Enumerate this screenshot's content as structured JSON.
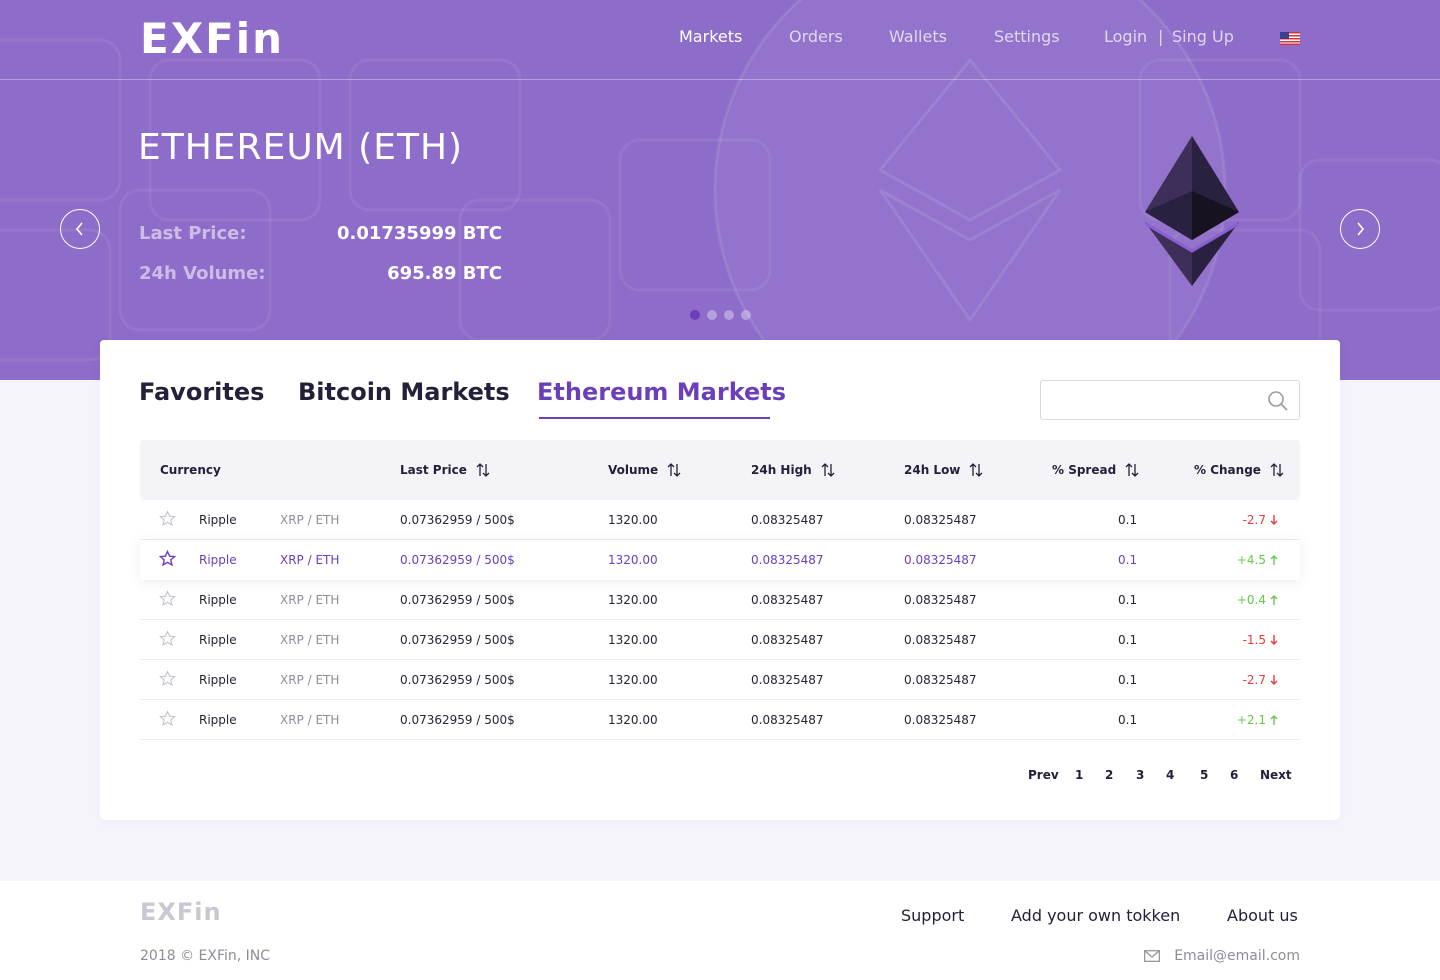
{
  "header": {
    "logo": "EXFin",
    "nav": [
      {
        "label": "Markets"
      },
      {
        "label": "Orders"
      },
      {
        "label": "Wallets"
      },
      {
        "label": "Settings"
      },
      {
        "label": "Login"
      },
      {
        "label": "Sing Up"
      }
    ],
    "nav_separator": "|",
    "language_flag_icon": "us-flag-icon"
  },
  "hero": {
    "title": "ETHEREUM (ETH)",
    "last_price_label": "Last Price:",
    "last_price_value": "0.01735999 BTC",
    "volume_label": "24h Volume:",
    "volume_value": "695.89 BTC",
    "prev_icon": "chevron-left-icon",
    "next_icon": "chevron-right-icon",
    "slide_count": 4,
    "active_slide": 1,
    "coin_icon": "ethereum-icon"
  },
  "markets": {
    "tabs": [
      {
        "label": "Favorites"
      },
      {
        "label": "Bitcoin Markets"
      },
      {
        "label": "Ethereum Markets"
      }
    ],
    "active_tab": 2,
    "search": {
      "value": "",
      "placeholder": "",
      "icon": "search-icon"
    },
    "columns": [
      {
        "label": "Currency",
        "sortable": false
      },
      {
        "label": "Last Price",
        "sortable": true
      },
      {
        "label": "Volume",
        "sortable": true
      },
      {
        "label": "24h High",
        "sortable": true
      },
      {
        "label": "24h Low",
        "sortable": true
      },
      {
        "label": "% Spread",
        "sortable": true
      },
      {
        "label": "% Change",
        "sortable": true
      }
    ],
    "rows": [
      {
        "name": "Ripple",
        "pair": "XRP / ETH",
        "last_price": "0.07362959 / 500$",
        "volume": "1320.00",
        "high": "0.08325487",
        "low": "0.08325487",
        "spread": "0.1",
        "change": "-2.7",
        "dir": "down",
        "favorite": false,
        "highlighted": false
      },
      {
        "name": "Ripple",
        "pair": "XRP / ETH",
        "last_price": "0.07362959 / 500$",
        "volume": "1320.00",
        "high": "0.08325487",
        "low": "0.08325487",
        "spread": "0.1",
        "change": "+4.5",
        "dir": "up",
        "favorite": true,
        "highlighted": true
      },
      {
        "name": "Ripple",
        "pair": "XRP / ETH",
        "last_price": "0.07362959 / 500$",
        "volume": "1320.00",
        "high": "0.08325487",
        "low": "0.08325487",
        "spread": "0.1",
        "change": "+0.4",
        "dir": "up",
        "favorite": false,
        "highlighted": false
      },
      {
        "name": "Ripple",
        "pair": "XRP / ETH",
        "last_price": "0.07362959 / 500$",
        "volume": "1320.00",
        "high": "0.08325487",
        "low": "0.08325487",
        "spread": "0.1",
        "change": "-1.5",
        "dir": "down",
        "favorite": false,
        "highlighted": false
      },
      {
        "name": "Ripple",
        "pair": "XRP / ETH",
        "last_price": "0.07362959 / 500$",
        "volume": "1320.00",
        "high": "0.08325487",
        "low": "0.08325487",
        "spread": "0.1",
        "change": "-2.7",
        "dir": "down",
        "favorite": false,
        "highlighted": false
      },
      {
        "name": "Ripple",
        "pair": "XRP / ETH",
        "last_price": "0.07362959 / 500$",
        "volume": "1320.00",
        "high": "0.08325487",
        "low": "0.08325487",
        "spread": "0.1",
        "change": "+2.1",
        "dir": "up",
        "favorite": false,
        "highlighted": false
      }
    ],
    "pagination": {
      "prev": "Prev",
      "pages": [
        "1",
        "2",
        "3",
        "4",
        "5",
        "6"
      ],
      "next": "Next"
    }
  },
  "footer": {
    "logo": "EXFin",
    "links": [
      {
        "label": "Support"
      },
      {
        "label": "Add your own tokken"
      },
      {
        "label": "About us"
      }
    ],
    "copyright": "2018 © EXFin, INC",
    "email": "Email@email.com",
    "email_icon": "envelope-icon"
  },
  "colors": {
    "hero_bg": "#8e6cc9",
    "accent": "#6b3fb8",
    "up": "#68c84e",
    "down": "#e63b3b"
  }
}
